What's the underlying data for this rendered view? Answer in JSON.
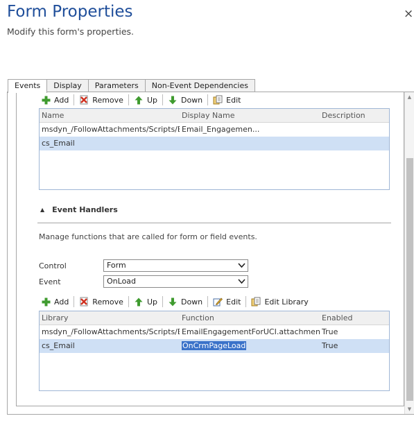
{
  "dialog": {
    "title": "Form Properties",
    "subtitle": "Modify this form's properties.",
    "close_glyph": "×"
  },
  "tabs": [
    "Events",
    "Display",
    "Parameters",
    "Non-Event Dependencies"
  ],
  "active_tab": "Events",
  "libraries_toolbar": {
    "add": "Add",
    "remove": "Remove",
    "up": "Up",
    "down": "Down",
    "edit": "Edit"
  },
  "libraries_grid": {
    "headers": [
      "Name",
      "Display Name",
      "Description"
    ],
    "rows": [
      {
        "name": "msdyn_/FollowAttachments/Scripts/Em...",
        "display_name": "Email_Engagemen...",
        "description": ""
      },
      {
        "name": "cs_Email",
        "display_name": "",
        "description": ""
      }
    ],
    "selected_row": 1
  },
  "event_handlers": {
    "heading": "Event Handlers",
    "description": "Manage functions that are called for form or field events.",
    "control_label": "Control",
    "control_value": "Form",
    "event_label": "Event",
    "event_value": "OnLoad"
  },
  "handlers_toolbar": {
    "add": "Add",
    "remove": "Remove",
    "up": "Up",
    "down": "Down",
    "edit": "Edit",
    "edit_library": "Edit Library"
  },
  "handlers_grid": {
    "headers": [
      "Library",
      "Function",
      "Enabled"
    ],
    "rows": [
      {
        "library": "msdyn_/FollowAttachments/Scripts/Em...",
        "function": "EmailEngagementForUCI.attachmentsG...",
        "enabled": "True"
      },
      {
        "library": "cs_Email",
        "function": "OnCrmPageLoad",
        "enabled": "True"
      }
    ],
    "selected_row": 1
  },
  "icons": {
    "add": "plus-icon",
    "remove": "remove-x-icon",
    "up": "arrow-up-icon",
    "down": "arrow-down-icon",
    "edit": "edit-icon",
    "edit_library": "library-icon"
  },
  "colors": {
    "title": "#1f4e9a",
    "selected_row": "#cfe0f5",
    "highlight": "#3a72c9",
    "grid_border": "#9fb6d5"
  }
}
